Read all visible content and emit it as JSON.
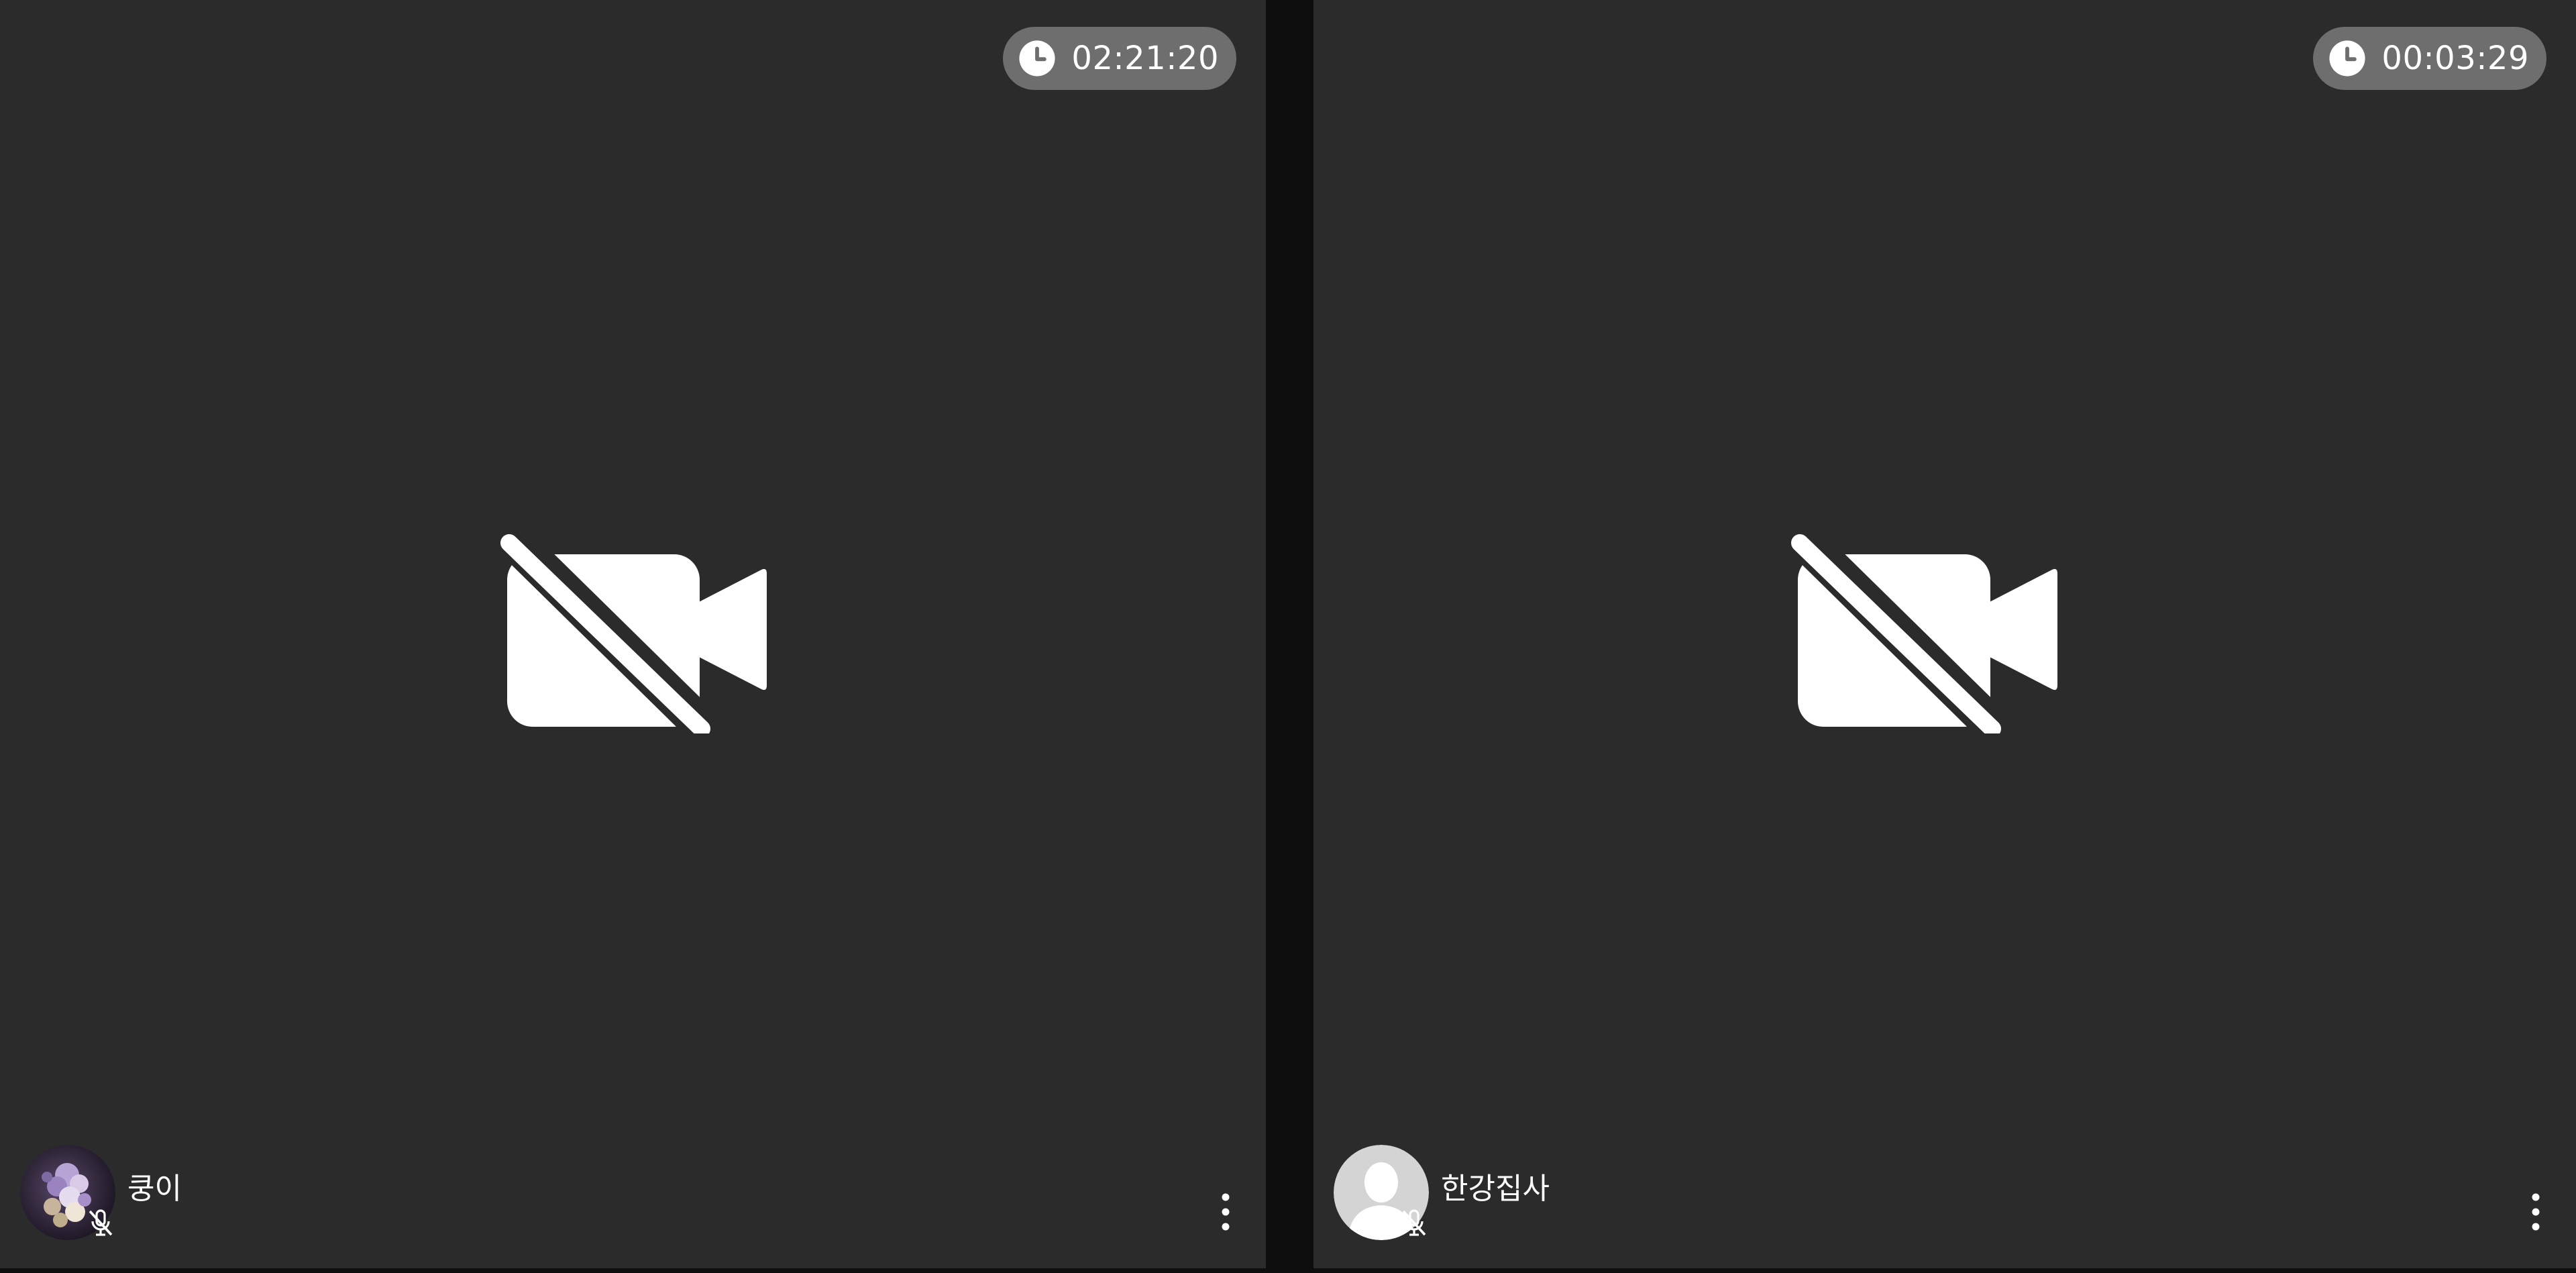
{
  "tiles": [
    {
      "timer": "02:21:20",
      "participant_name": "쿵이",
      "camera_status_icon": "video-off-icon",
      "mic_status_icon": "mic-off-icon",
      "avatar_type": "photo"
    },
    {
      "timer": "00:03:29",
      "participant_name": "한강집사",
      "camera_status_icon": "video-off-icon",
      "mic_status_icon": "mic-off-icon",
      "avatar_type": "default-silhouette"
    }
  ],
  "colors": {
    "tile_background": "#2b2b2b",
    "gutter": "#0e0e0e",
    "timer_pill": "#6e6e6e",
    "icon": "#ffffff"
  },
  "icons": {
    "timer": "clock-icon",
    "options": "more-vertical-icon"
  }
}
